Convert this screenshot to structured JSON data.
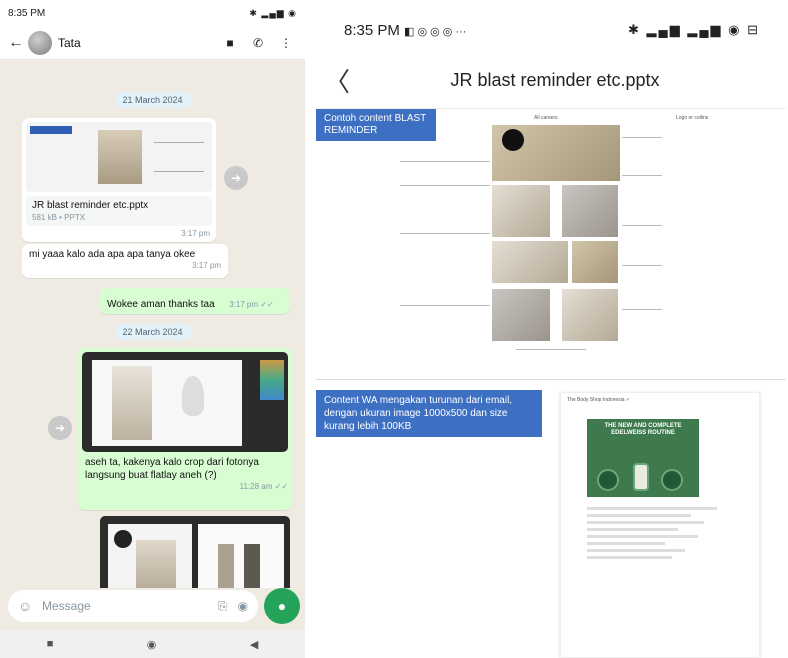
{
  "left": {
    "status": {
      "time": "8:35 PM",
      "icons": "◧ ◎ ◎ ···",
      "right": "✱ ▂▄▆ ◉"
    },
    "header": {
      "back": "←",
      "contact": "Tata",
      "video_icon": "■",
      "call_icon": "✆",
      "menu_icon": "⋮"
    },
    "date1": "21 March 2024",
    "doc": {
      "name": "JR blast reminder etc.pptx",
      "meta": "581 kB • PPTX",
      "time": "3:17 pm"
    },
    "msg1": {
      "text": "mi yaaa kalo ada apa apa tanya okee",
      "time": "3:17 pm"
    },
    "msg2": {
      "text": "Wokee aman thanks taa",
      "time": "3:17 pm ✓✓"
    },
    "date2": "22 March 2024",
    "msg3": {
      "text": "aseh ta, kakenya kalo crop dari fotonya langsung buat flatlay aneh (?)",
      "time": "11:28 am ✓✓"
    },
    "compose": {
      "placeholder": "Message",
      "emoji": "☺",
      "attach": "⎘",
      "camera": "◉",
      "mic": "●"
    },
    "nav": {
      "a": "■",
      "b": "◉",
      "c": "◀"
    }
  },
  "right": {
    "status": {
      "time": "8:35 PM",
      "icons": "◧ ◎ ◎ ◎ ···",
      "right": "✱ ▂▄▆ ▂▄▆ ◉ ⊟"
    },
    "title": "JR blast reminder etc.pptx",
    "back": "〈",
    "slide1_tag": "Contoh content BLAST REMINDER",
    "slide1_header_label": "All careers",
    "slide1_logo_label": "Logo or collins",
    "slide2_tag": "Content WA mengakan turunan dari email, dengan ukuran image 1000x500 dan size kurang lebih 100KB",
    "card_header": "The Body Shop Indonesia ✓",
    "promo_text": "THE NEW AND COMPLETE EDELWEISS ROUTINE"
  }
}
